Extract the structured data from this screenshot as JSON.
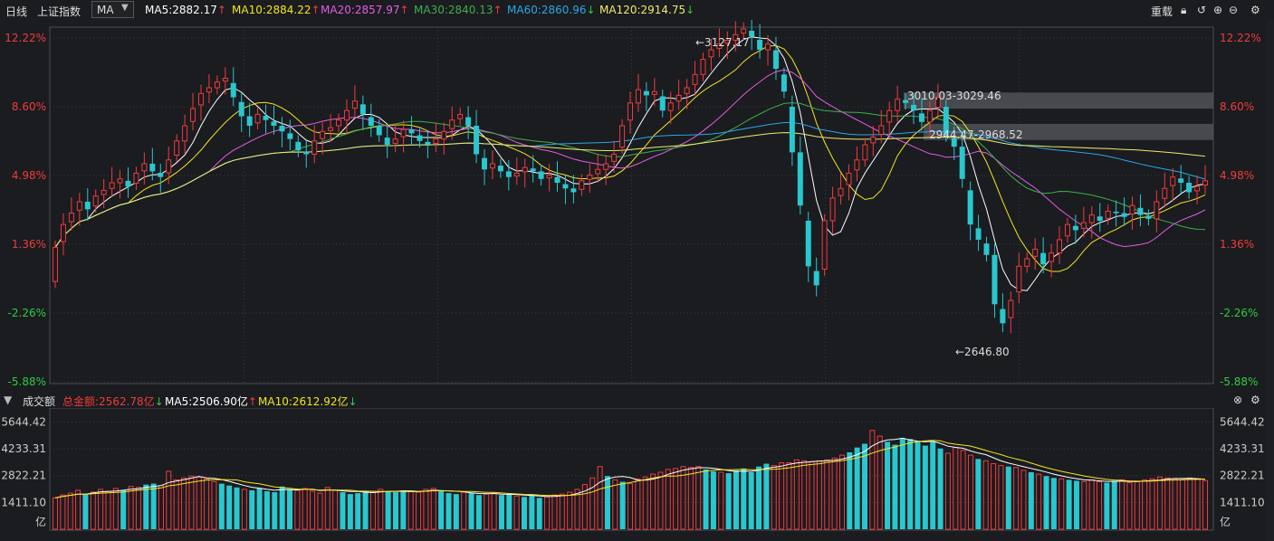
{
  "header": {
    "period_tab": "日线",
    "index_name": "上证指数",
    "indicator_select": "MA",
    "ma_readouts": [
      {
        "label": "MA5:2882.17",
        "arrow": "↑",
        "color": "#ffffff"
      },
      {
        "label": "MA10:2884.22",
        "arrow": "↑",
        "color": "#f5e51e"
      },
      {
        "label": "MA20:2857.97",
        "arrow": "↑",
        "color": "#e45ce4"
      },
      {
        "label": "MA30:2840.13",
        "arrow": "↑",
        "color": "#3fae4a"
      },
      {
        "label": "MA60:2860.96",
        "arrow": "↓",
        "color": "#2aa7e8"
      },
      {
        "label": "MA120:2914.75",
        "arrow": "↓",
        "color": "#f0ec6a"
      }
    ],
    "right_label": "重载"
  },
  "colors": {
    "up": "#f33a3a",
    "down": "#2ac7cf",
    "bg": "#1a1c20",
    "grid": "#3a3d45",
    "pct_up": "#f33a3a",
    "pct_down": "#2ecc40"
  },
  "chart_data": [
    {
      "type": "candlestick",
      "title": "上证指数",
      "y_axis_left": [
        "12.22%",
        "8.60%",
        "4.98%",
        "1.36%",
        "-2.26%",
        "-5.88%"
      ],
      "y_axis_right": [
        "12.22%",
        "8.60%",
        "4.98%",
        "1.36%",
        "-2.26%",
        "-5.88%"
      ],
      "ylim": [
        -5.88,
        12.22
      ],
      "annotations": {
        "high": "3127.17",
        "low": "2646.80",
        "zone_upper": "3010.03-3029.46",
        "zone_lower": "2944.47-2968.52"
      },
      "moving_averages": [
        "MA5",
        "MA10",
        "MA20",
        "MA30",
        "MA60",
        "MA120"
      ],
      "closes_pct": [
        1.2,
        2.4,
        3.0,
        3.6,
        3.2,
        3.9,
        4.2,
        4.6,
        4.8,
        4.4,
        5.1,
        5.6,
        5.2,
        4.9,
        5.8,
        6.8,
        7.6,
        8.5,
        9.3,
        9.6,
        9.9,
        10.1,
        9.1,
        8.1,
        7.6,
        8.2,
        7.9,
        7.6,
        7.3,
        6.9,
        6.3,
        6.1,
        6.8,
        7.3,
        7.5,
        7.9,
        8.4,
        8.9,
        8.2,
        7.6,
        7.1,
        6.6,
        6.9,
        7.4,
        7.2,
        6.8,
        6.6,
        6.9,
        7.3,
        7.9,
        8.2,
        7.6,
        6.1,
        5.3,
        5.6,
        5.2,
        4.9,
        5.1,
        5.4,
        5.2,
        4.8,
        5.0,
        4.6,
        4.3,
        4.1,
        4.7,
        5.0,
        5.3,
        5.6,
        6.1,
        7.6,
        8.8,
        9.5,
        9.2,
        9.4,
        8.4,
        8.8,
        9.2,
        9.6,
        10.3,
        11.1,
        11.6,
        11.9,
        12.1,
        12.4,
        12.7,
        12.3,
        11.6,
        11.9,
        10.6,
        9.4,
        6.2,
        3.4,
        0.2,
        -0.8,
        2.6,
        3.8,
        4.3,
        5.1,
        5.8,
        6.6,
        7.0,
        7.6,
        8.4,
        9.0,
        8.8,
        8.4,
        7.8,
        8.4,
        9.1,
        7.1,
        6.5,
        4.8,
        2.4,
        1.6,
        0.8,
        -1.8,
        -2.8,
        -1.6,
        0.2,
        0.6,
        1.1,
        0.3,
        0.9,
        1.6,
        2.4,
        2.1,
        2.5,
        2.9,
        2.6,
        3.1,
        3.0,
        2.8,
        3.4,
        2.9,
        2.7,
        3.6,
        4.3,
        4.9,
        4.6,
        4.1,
        4.4,
        4.7
      ],
      "volume_panel": {
        "title": "成交额",
        "total_label": "总金额:2562.78亿",
        "total_arrow": "↓",
        "ma5_label": "MA5:2506.90亿",
        "ma5_arrow": "↑",
        "ma10_label": "MA10:2612.92亿",
        "ma10_arrow": "↓",
        "y_axis": [
          "5644.42",
          "4233.31",
          "2822.21",
          "1411.10",
          "亿"
        ],
        "ylim": [
          0,
          6000
        ],
        "values": [
          1650,
          1800,
          1900,
          2050,
          1850,
          1950,
          2100,
          2000,
          2150,
          2050,
          2250,
          2200,
          2350,
          2400,
          2300,
          3050,
          2600,
          2700,
          2800,
          2750,
          2650,
          2500,
          2400,
          2300,
          2200,
          2100,
          2050,
          2150,
          2000,
          1950,
          2250,
          2100,
          2050,
          2150,
          2000,
          1900,
          2200,
          2050,
          1950,
          1850,
          1900,
          2000,
          1950,
          2100,
          2000,
          1950,
          2050,
          2000,
          1950,
          2100,
          2150,
          2000,
          1900,
          1850,
          1950,
          1900,
          1800,
          1850,
          1900,
          1800,
          1850,
          1750,
          1700,
          1800,
          1650,
          1700,
          1800,
          1850,
          1950,
          2100,
          2350,
          2700,
          3300,
          2800,
          2600,
          2500,
          2400,
          2650,
          2750,
          2900,
          3000,
          3150,
          3200,
          3300,
          3250,
          3300,
          3150,
          3050,
          3000,
          2950,
          3100,
          3200,
          3000,
          3300,
          3450,
          3350,
          3500,
          3500,
          3650,
          3600,
          3550,
          3600,
          3650,
          3750,
          3900,
          4050,
          4300,
          4500,
          5200,
          4900,
          4600,
          4450,
          4800,
          4750,
          4600,
          4400,
          4600,
          4250,
          4000,
          4300,
          4150,
          3900,
          3700,
          3600,
          3450,
          3350,
          3300,
          3250,
          3100,
          3000,
          2900,
          2800,
          2700,
          2650,
          2600,
          2550,
          2500,
          2600,
          2500,
          2450,
          2550,
          2600,
          2450,
          2500,
          2600,
          2650,
          2750,
          2700,
          2650,
          2600,
          2700,
          2650,
          2560
        ]
      }
    }
  ]
}
